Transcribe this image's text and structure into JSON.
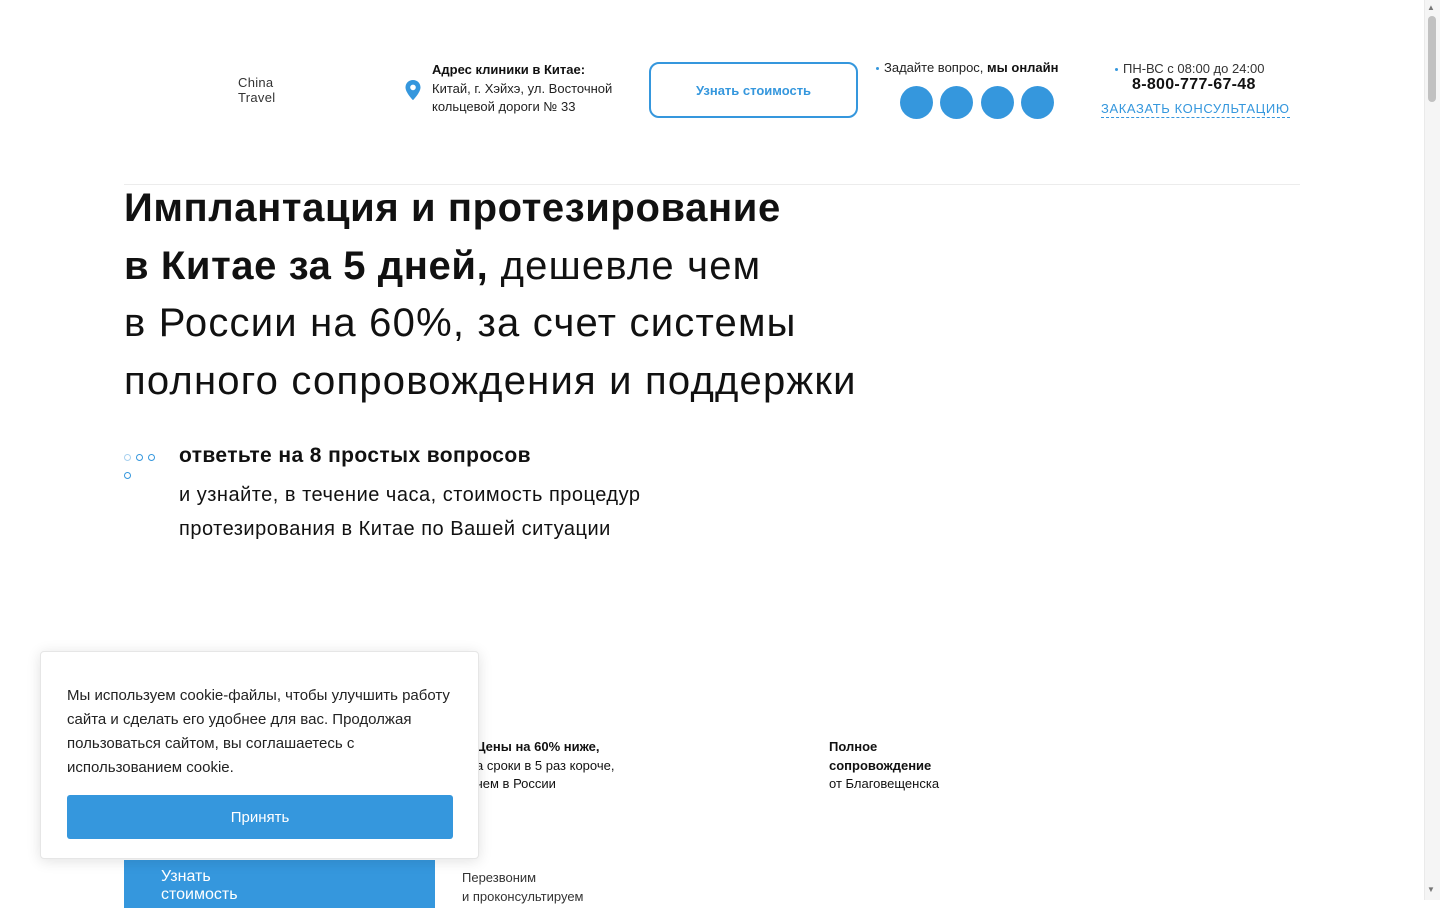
{
  "header": {
    "logo_text": "China\nTravel",
    "address_title": "Адрес клиники в Китае:",
    "address_line1": "Китай, г. Хэйхэ, ул. Восточной",
    "address_line2": "кольцевой дороги № 33",
    "cost_button": "Узнать стоимость",
    "ask_prefix": "Задайте вопрос,",
    "ask_online": "мы онлайн",
    "hours": "ПН-ВС с 08:00 до 24:00",
    "phone": "8-800-777-67-48",
    "consult_link": "ЗАКАЗАТЬ КОНСУЛЬТАЦИЮ",
    "social_icons": [
      "social-icon-1",
      "social-icon-2",
      "social-icon-3",
      "social-icon-4"
    ]
  },
  "hero": {
    "title_bold_1": "Имплантация и протезирование",
    "title_bold_2": "в Китае за 5 дней,",
    "title_light_1": "дешевле чем",
    "title_light_2": "в России на 60%, за счет системы",
    "title_light_3": "полного сопровождения и поддержки"
  },
  "quiz": {
    "title": "ответьте на 8 простых вопросов",
    "sub_line1": "и узнайте, в течение часа, стоимость процедур",
    "sub_line2": "протезирования в Китае по Вашей ситуации"
  },
  "features": [
    {
      "bold": "Цены на 60% ниже,",
      "line2": "а сроки в 5 раз короче,",
      "line3": "чем в России"
    },
    {
      "bold1": "Полное",
      "bold2": "сопровождение",
      "line3": "от Благовещенска"
    }
  ],
  "cta": {
    "button_line1": "Узнать",
    "button_line2": "стоимость",
    "callback_line1": "Перезвоним",
    "callback_line2": "и проконсультируем"
  },
  "cookie": {
    "text": "Мы используем cookie-файлы, чтобы улучшить работу сайта и сделать его удобнее для вас. Продолжая пользоваться сайтом, вы соглашаетесь с использованием cookie.",
    "accept": "Принять"
  },
  "colors": {
    "accent": "#3597dd",
    "text": "#111111"
  }
}
